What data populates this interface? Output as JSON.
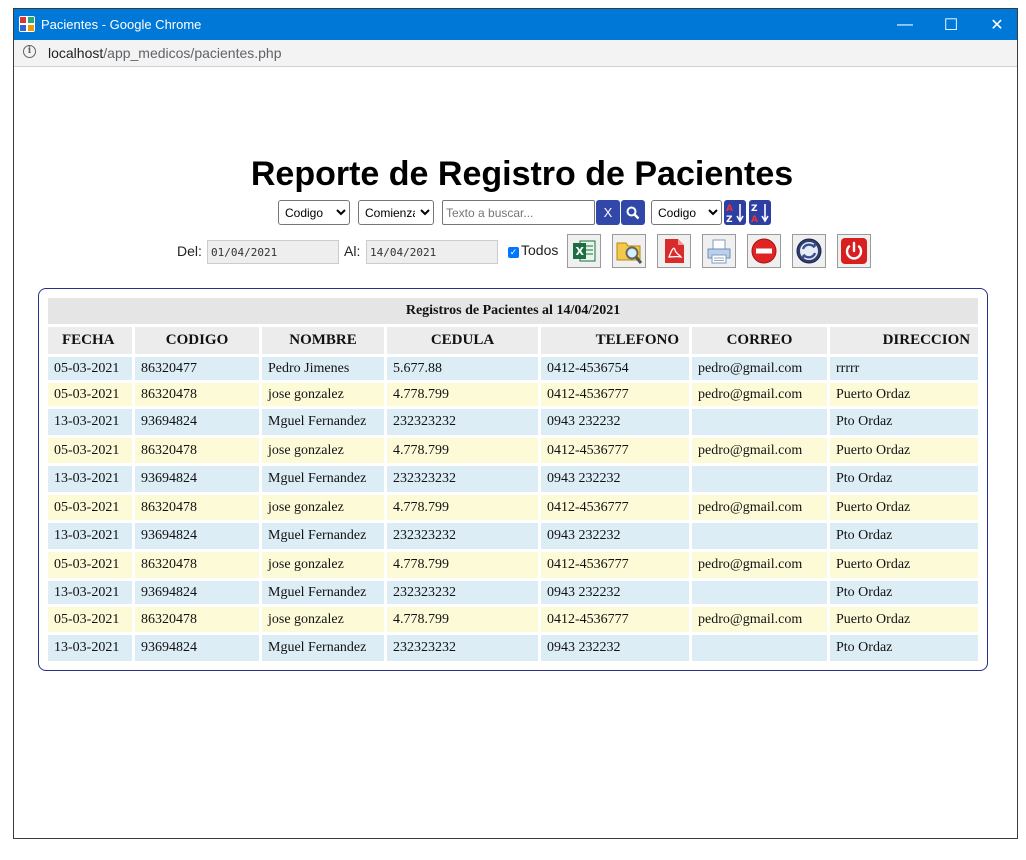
{
  "window": {
    "title": "Pacientes - Google Chrome",
    "controls": {
      "minimize": "—",
      "maximize": "☐",
      "close": "✕"
    }
  },
  "address": {
    "host": "localhost",
    "path": "/app_medicos/pacientes.php"
  },
  "page": {
    "title": "Reporte de Registro de Pacientes",
    "filter": {
      "field_select": "Codigo",
      "mode_select": "Comienza",
      "search_placeholder": "Texto a buscar...",
      "clear_label": "X",
      "sort_select": "Codigo"
    },
    "dates": {
      "from_label": "Del:",
      "from_value": "01/04/2021",
      "to_label": "Al:",
      "to_value": "14/04/2021",
      "all_label": "Todos",
      "all_checked": true
    },
    "toolbar_icons": [
      "excel-icon",
      "preview-icon",
      "pdf-icon",
      "print-icon",
      "stop-icon",
      "refresh-icon",
      "power-icon"
    ],
    "table": {
      "caption": "Registros de Pacientes al 14/04/2021",
      "columns": [
        "FECHA",
        "CODIGO",
        "NOMBRE",
        "CEDULA",
        "TELEFONO",
        "CORREO",
        "DIRECCION"
      ],
      "rows": [
        [
          "05-03-2021",
          "86320477",
          "Pedro Jimenes",
          "5.677.88",
          "0412-4536754",
          "pedro@gmail.com",
          "rrrrr"
        ],
        [
          "05-03-2021",
          "86320478",
          "jose gonzalez",
          "4.778.799",
          "0412-4536777",
          "pedro@gmail.com",
          "Puerto Ordaz"
        ],
        [
          "13-03-2021",
          "93694824",
          "Mguel Fernandez",
          "232323232",
          "0943 232232",
          "",
          "Pto Ordaz"
        ],
        [
          "05-03-2021",
          "86320478",
          "jose gonzalez",
          "4.778.799",
          "0412-4536777",
          "pedro@gmail.com",
          "Puerto Ordaz"
        ],
        [
          "13-03-2021",
          "93694824",
          "Mguel Fernandez",
          "232323232",
          "0943 232232",
          "",
          "Pto Ordaz"
        ],
        [
          "05-03-2021",
          "86320478",
          "jose gonzalez",
          "4.778.799",
          "0412-4536777",
          "pedro@gmail.com",
          "Puerto Ordaz"
        ],
        [
          "13-03-2021",
          "93694824",
          "Mguel Fernandez",
          "232323232",
          "0943 232232",
          "",
          "Pto Ordaz"
        ],
        [
          "05-03-2021",
          "86320478",
          "jose gonzalez",
          "4.778.799",
          "0412-4536777",
          "pedro@gmail.com",
          "Puerto Ordaz"
        ],
        [
          "13-03-2021",
          "93694824",
          "Mguel Fernandez",
          "232323232",
          "0943 232232",
          "",
          "Pto Ordaz"
        ],
        [
          "05-03-2021",
          "86320478",
          "jose gonzalez",
          "4.778.799",
          "0412-4536777",
          "pedro@gmail.com",
          "Puerto Ordaz"
        ],
        [
          "13-03-2021",
          "93694824",
          "Mguel Fernandez",
          "232323232",
          "0943 232232",
          "",
          "Pto Ordaz"
        ]
      ]
    }
  },
  "colors": {
    "titlebar": "#0078d7",
    "panel_border": "#26308d",
    "row_blue": "#dcedf6",
    "row_yellow": "#fdfad8",
    "button_blue": "#3248a8"
  }
}
